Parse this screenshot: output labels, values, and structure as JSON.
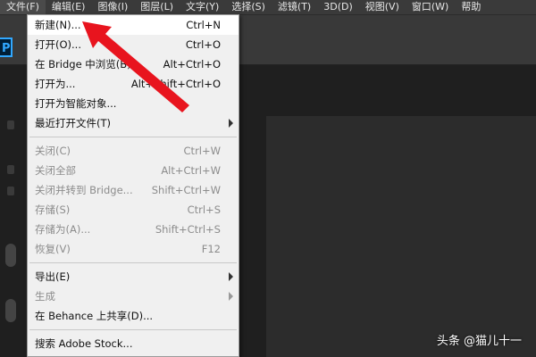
{
  "menubar": {
    "items": [
      {
        "label": "文件(F)",
        "active": true
      },
      {
        "label": "编辑(E)"
      },
      {
        "label": "图像(I)"
      },
      {
        "label": "图层(L)"
      },
      {
        "label": "文字(Y)"
      },
      {
        "label": "选择(S)"
      },
      {
        "label": "滤镜(T)"
      },
      {
        "label": "3D(D)"
      },
      {
        "label": "视图(V)"
      },
      {
        "label": "窗口(W)"
      },
      {
        "label": "帮助"
      }
    ]
  },
  "app": {
    "logo_text": "P"
  },
  "file_menu": {
    "groups": [
      [
        {
          "label": "新建(N)...",
          "shortcut": "Ctrl+N",
          "enabled": true
        },
        {
          "label": "打开(O)...",
          "shortcut": "Ctrl+O",
          "enabled": true
        },
        {
          "label": "在 Bridge 中浏览(B)...",
          "shortcut": "Alt+Ctrl+O",
          "enabled": true
        },
        {
          "label": "打开为...",
          "shortcut": "Alt+Shift+Ctrl+O",
          "enabled": true
        },
        {
          "label": "打开为智能对象...",
          "shortcut": "",
          "enabled": true
        },
        {
          "label": "最近打开文件(T)",
          "shortcut": "",
          "enabled": true,
          "submenu": true
        }
      ],
      [
        {
          "label": "关闭(C)",
          "shortcut": "Ctrl+W",
          "enabled": false
        },
        {
          "label": "关闭全部",
          "shortcut": "Alt+Ctrl+W",
          "enabled": false
        },
        {
          "label": "关闭并转到 Bridge...",
          "shortcut": "Shift+Ctrl+W",
          "enabled": false
        },
        {
          "label": "存储(S)",
          "shortcut": "Ctrl+S",
          "enabled": false
        },
        {
          "label": "存储为(A)...",
          "shortcut": "Shift+Ctrl+S",
          "enabled": false
        },
        {
          "label": "恢复(V)",
          "shortcut": "F12",
          "enabled": false
        }
      ],
      [
        {
          "label": "导出(E)",
          "shortcut": "",
          "enabled": true,
          "submenu": true
        },
        {
          "label": "生成",
          "shortcut": "",
          "enabled": false,
          "submenu": true
        },
        {
          "label": "在 Behance 上共享(D)...",
          "shortcut": "",
          "enabled": true
        }
      ],
      [
        {
          "label": "搜索 Adobe Stock...",
          "shortcut": "",
          "enabled": true
        }
      ]
    ]
  },
  "watermark": "头条 @猫儿十一",
  "colors": {
    "arrow": "#e8141e",
    "ps_blue": "#31a8ff"
  }
}
